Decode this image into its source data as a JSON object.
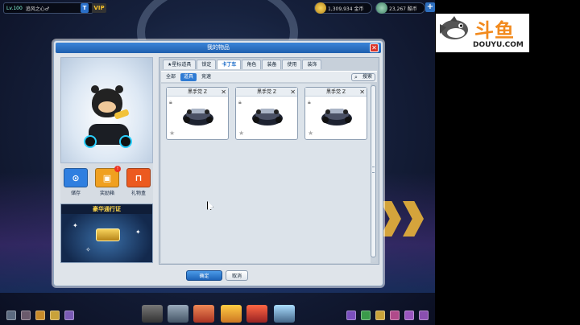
{
  "hud": {
    "level": "Lv.100",
    "name": "追风之心♂",
    "vip": "VIP",
    "t_badge": "T",
    "coins": "1,309,934 金币",
    "points": "23,267 酷币"
  },
  "dialog": {
    "title": "我的物品",
    "close_glyph": "✕"
  },
  "left": {
    "actions": [
      {
        "label": "储存",
        "glyph": "⊙",
        "color": "#2f7fe0"
      },
      {
        "label": "奖励箱",
        "glyph": "▣",
        "color": "#f0a020"
      },
      {
        "label": "礼物盒",
        "glyph": "⊓",
        "color": "#ec5a1f"
      }
    ],
    "pass_title": "豪华通行证",
    "badge": "!"
  },
  "tabs": [
    "★星标道具",
    "锁定",
    "卡丁车",
    "角色",
    "装备",
    "使用",
    "装饰"
  ],
  "active_tab": 2,
  "subtabs": [
    "全部",
    "道具",
    "竞速"
  ],
  "active_subtab": 1,
  "search_label": "搜索",
  "items": [
    {
      "name": "黑手党 Z"
    },
    {
      "name": "黑手党 Z"
    },
    {
      "name": "黑手党 Z"
    }
  ],
  "buttons": {
    "ok": "确定",
    "cancel": "取消"
  },
  "logo": {
    "cn": "斗鱼",
    "en": "DOUYU.COM"
  }
}
